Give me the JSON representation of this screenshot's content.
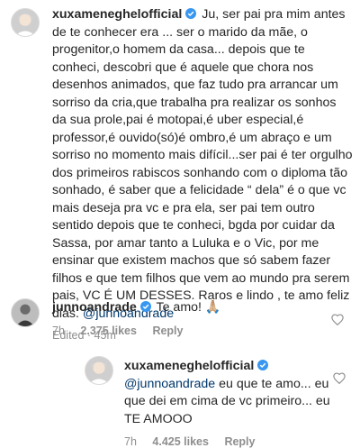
{
  "post": {
    "username": "xuxameneghelofficial",
    "mention": "@junnoandrade",
    "body": " Ju, ser pai pra mim antes de te conhecer era ... ser o marido da mãe, o progenitor,o homem da casa... depois que te conheci, descobri que é aquele que chora nos desenhos animados, que faz tudo pra arrancar um sorriso da cria,que trabalha pra realizar os  sonhos da sua prole,pai é motopai,é uber especial,é professor,é ouvido(só)é ombro,é um abraço e um sorriso no momento mais difícil...ser pai é ter orgulho dos primeiros rabiscos sonhando com o diploma tão sonhado, é saber que a felicidade “ dela” é o que vc mais deseja pra vc e pra ela, ser pai tem outro sentido depois que te conheci, bgda por cuidar da Sassa, por amar tanto a Luluka e o Vic, por me ensinar que existem machos que só sabem fazer filhos e que tem filhos que vem ao mundo pra serem pais, VC É UM DESSES. Raros e lindo , te amo feliz dias. ",
    "edited": "Edited · 45m"
  },
  "comment": {
    "username": "junnoandrade",
    "text": " Te amo! 🙏🏼",
    "time": "7h",
    "likes": "2.375 likes",
    "reply": "Reply"
  },
  "reply": {
    "username": "xuxameneghelofficial",
    "mention": "@junnoandrade",
    "text": "eu que te amo... eu que dei em cima de vc primeiro... eu TE AMOOO",
    "time": "7h",
    "likes": "4.425 likes",
    "reply": "Reply"
  },
  "colors": {
    "verified": "#3897f0",
    "link": "#00376b",
    "meta": "#8e8e8e"
  },
  "icons": [
    "verified-badge-icon",
    "heart-outline-icon"
  ]
}
